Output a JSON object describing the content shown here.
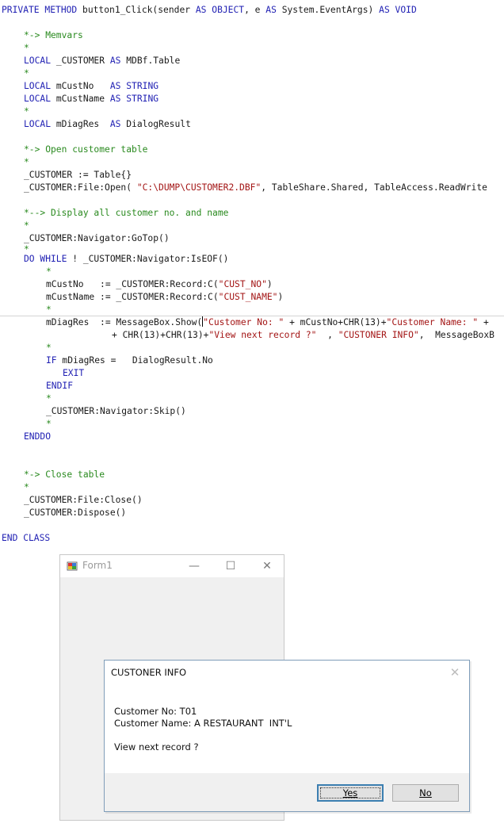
{
  "code": {
    "line_01": "PRIVATE METHOD button1_Click(sender AS OBJECT, e AS System.EventArgs) AS VOID",
    "line_02": "*-> Memvars",
    "line_03": "*",
    "line_04": "LOCAL _CUSTOMER AS MDBf.Table",
    "line_05": "*",
    "line_06": "LOCAL mCustNo   AS STRING",
    "line_07": "LOCAL mCustName AS STRING",
    "line_08": "*",
    "line_09": "LOCAL mDiagRes  AS DialogResult",
    "line_10": "*-> Open customer table",
    "line_11": "*",
    "line_12": "_CUSTOMER := Table{}",
    "line_13": "_CUSTOMER:File:Open( \"C:\\DUMP\\CUSTOMER2.DBF\", TableShare.Shared, TableAccess.ReadWrite",
    "line_14": "*--> Display all customer no. and name",
    "line_15": "*",
    "line_16": "_CUSTOMER:Navigator:GoTop()",
    "line_17": "*",
    "line_18": "DO WHILE ! _CUSTOMER:Navigator:IsEOF()",
    "line_19": "*",
    "line_20": "mCustNo   := _CUSTOMER:Record:C(\"CUST_NO\")",
    "line_21": "mCustName := _CUSTOMER:Record:C(\"CUST_NAME\")",
    "line_22": "*",
    "line_23": "mDiagRes  := MessageBox.Show(\"Customer No: \" + mCustNo+CHR(13)+\"Customer Name: \" +",
    "line_24": "+ CHR(13)+CHR(13)+\"View next record ?\"  , \"CUSTONER INFO\",  MessageBoxB",
    "line_25": "*",
    "line_26": "IF mDiagRes =   DialogResult.No",
    "line_27": "EXIT",
    "line_28": "ENDIF",
    "line_29": "*",
    "line_30": "_CUSTOMER:Navigator:Skip()",
    "line_31": "*",
    "line_32": "ENDDO",
    "line_33": "*-> Close table",
    "line_34": "*",
    "line_35": "_CUSTOMER:File:Close()",
    "line_36": "_CUSTOMER:Dispose()",
    "line_37": "END CLASS"
  },
  "form1": {
    "title": "Form1",
    "minimize": "—",
    "maximize": "☐",
    "close": "✕"
  },
  "messagebox": {
    "title": "CUSTONER INFO",
    "close": "✕",
    "line1": "Customer No: T01",
    "line2": "Customer Name: A RESTAURANT  INT'L",
    "line3": "View next record ?",
    "yes_label": "Yes",
    "no_label": "No"
  },
  "colors": {
    "keyword": "#1f1fb3",
    "comment": "#2a8a1f",
    "string": "#a31515",
    "default_button_border": "#3c7fb1"
  }
}
